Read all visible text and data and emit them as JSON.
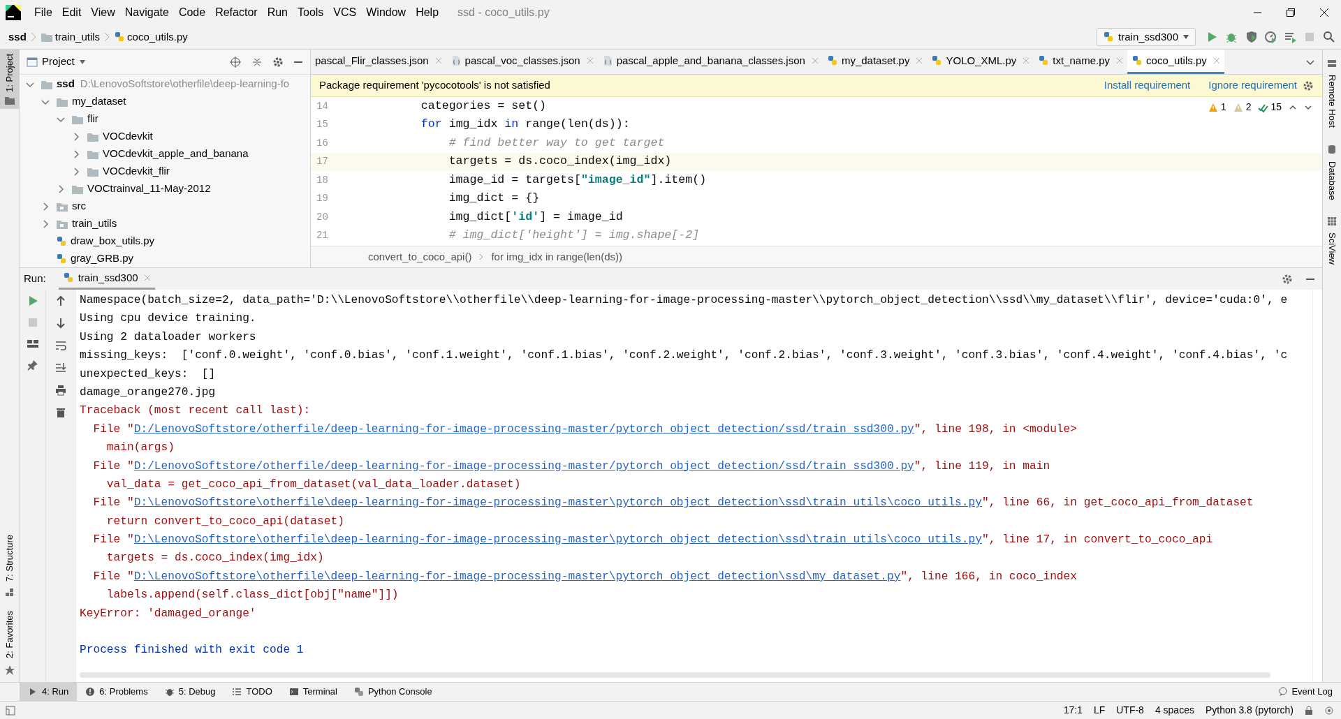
{
  "menu": [
    "File",
    "Edit",
    "View",
    "Navigate",
    "Code",
    "Refactor",
    "Run",
    "Tools",
    "VCS",
    "Window",
    "Help"
  ],
  "window": {
    "title": "ssd - coco_utils.py"
  },
  "nav": {
    "breadcrumbs": [
      {
        "label": "ssd",
        "kind": "project"
      },
      {
        "label": "train_utils",
        "kind": "folder"
      },
      {
        "label": "coco_utils.py",
        "kind": "python_file"
      }
    ],
    "run_config": "train_ssd300"
  },
  "left_strip": [
    "1: Project",
    "7: Structure",
    "2: Favorites"
  ],
  "right_strip": [
    "Remote Host",
    "Database",
    "SciView"
  ],
  "project": {
    "title": "Project",
    "tree": [
      {
        "label": "ssd",
        "path": "D:\\LenovoSoftstore\\otherfile\\deep-learning-fo",
        "kind": "folder",
        "expanded": true,
        "children": [
          {
            "label": "my_dataset",
            "kind": "folder",
            "expanded": true,
            "children": [
              {
                "label": "flir",
                "kind": "folder",
                "expanded": true,
                "children": [
                  {
                    "label": "VOCdevkit",
                    "kind": "folder",
                    "expanded": false
                  },
                  {
                    "label": "VOCdevkit_apple_and_banana",
                    "kind": "folder",
                    "expanded": false
                  },
                  {
                    "label": "VOCdevkit_flir",
                    "kind": "folder",
                    "expanded": false
                  }
                ]
              },
              {
                "label": "VOCtrainval_11-May-2012",
                "kind": "folder",
                "expanded": false
              }
            ]
          },
          {
            "label": "src",
            "kind": "package",
            "expanded": false
          },
          {
            "label": "train_utils",
            "kind": "package",
            "expanded": false
          },
          {
            "label": "draw_box_utils.py",
            "kind": "python_file"
          },
          {
            "label": "gray_GRB.py",
            "kind": "python_file"
          }
        ]
      }
    ]
  },
  "editor_tabs": [
    {
      "label": "pascal_Flir_classes.json",
      "kind": "plain",
      "selected": false
    },
    {
      "label": "pascal_voc_classes.json",
      "kind": "json",
      "selected": false
    },
    {
      "label": "pascal_apple_and_banana_classes.json",
      "kind": "json",
      "selected": false
    },
    {
      "label": "my_dataset.py",
      "kind": "python",
      "selected": false
    },
    {
      "label": "YOLO_XML.py",
      "kind": "python",
      "selected": false
    },
    {
      "label": "txt_name.py",
      "kind": "python",
      "selected": false
    },
    {
      "label": "coco_utils.py",
      "kind": "python",
      "selected": true
    }
  ],
  "banner": {
    "message": "Package requirement 'pycocotools' is not satisfied",
    "actions": [
      "Install requirement",
      "Ignore requirement"
    ]
  },
  "inspections": [
    {
      "kind": "warning",
      "count": "1"
    },
    {
      "kind": "weak_warning",
      "count": "2"
    },
    {
      "kind": "typo",
      "count": "15"
    }
  ],
  "code": [
    {
      "number": "14",
      "current": false,
      "tokens": [
        {
          "kind": "plain",
          "text": "    categories = set()"
        }
      ]
    },
    {
      "number": "15",
      "current": false,
      "tokens": [
        {
          "kind": "keyword",
          "text": "    for"
        },
        {
          "kind": "plain",
          "text": " img_idx "
        },
        {
          "kind": "keyword",
          "text": "in"
        },
        {
          "kind": "plain",
          "text": " range(len(ds)):"
        }
      ]
    },
    {
      "number": "16",
      "current": false,
      "tokens": [
        {
          "kind": "comment",
          "text": "        # find better way to get target"
        }
      ]
    },
    {
      "number": "17",
      "current": true,
      "tokens": [
        {
          "kind": "plain",
          "text": "        targets = ds.coco_index(img_idx)"
        }
      ]
    },
    {
      "number": "18",
      "current": false,
      "tokens": [
        {
          "kind": "plain",
          "text": "        image_id = targets["
        },
        {
          "kind": "string",
          "text": "\"image_id\""
        },
        {
          "kind": "plain",
          "text": "].item()"
        }
      ]
    },
    {
      "number": "19",
      "current": false,
      "tokens": [
        {
          "kind": "plain",
          "text": "        img_dict = {}"
        }
      ]
    },
    {
      "number": "20",
      "current": false,
      "tokens": [
        {
          "kind": "plain",
          "text": "        img_dict["
        },
        {
          "kind": "string",
          "text": "'id'"
        },
        {
          "kind": "plain",
          "text": "] = image_id"
        }
      ]
    },
    {
      "number": "21",
      "current": false,
      "tokens": [
        {
          "kind": "comment",
          "text": "        # img_dict['height'] = img.shape[-2]"
        }
      ]
    }
  ],
  "code_breadcrumbs": [
    "convert_to_coco_api()",
    "for img_idx in range(len(ds))"
  ],
  "run": {
    "label": "Run:",
    "tab": "train_ssd300",
    "console": [
      {
        "kind": "output",
        "parts": [
          {
            "kind": "text",
            "text": "Namespace(batch_size=2, data_path='D:\\\\LenovoSoftstore\\\\otherfile\\\\deep-learning-for-image-processing-master\\\\pytorch_object_detection\\\\ssd\\\\my_dataset\\\\flir', device='cuda:0', e"
          }
        ]
      },
      {
        "kind": "output",
        "parts": [
          {
            "kind": "text",
            "text": "Using cpu device training."
          }
        ]
      },
      {
        "kind": "output",
        "parts": [
          {
            "kind": "text",
            "text": "Using 2 dataloader workers"
          }
        ]
      },
      {
        "kind": "output",
        "parts": [
          {
            "kind": "text",
            "text": "missing_keys:  ['conf.0.weight', 'conf.0.bias', 'conf.1.weight', 'conf.1.bias', 'conf.2.weight', 'conf.2.bias', 'conf.3.weight', 'conf.3.bias', 'conf.4.weight', 'conf.4.bias', 'c"
          }
        ]
      },
      {
        "kind": "output",
        "parts": [
          {
            "kind": "text",
            "text": "unexpected_keys:  []"
          }
        ]
      },
      {
        "kind": "output",
        "parts": [
          {
            "kind": "text",
            "text": "damage_orange270.jpg"
          }
        ]
      },
      {
        "kind": "error",
        "parts": [
          {
            "kind": "text",
            "text": "Traceback (most recent call last):"
          }
        ]
      },
      {
        "kind": "error",
        "parts": [
          {
            "kind": "text",
            "text": "  File \""
          },
          {
            "kind": "link",
            "text": "D:/LenovoSoftstore/otherfile/deep-learning-for-image-processing-master/pytorch_object_detection/ssd/train_ssd300.py"
          },
          {
            "kind": "text",
            "text": "\", line 198, in <module>"
          }
        ]
      },
      {
        "kind": "error",
        "parts": [
          {
            "kind": "text",
            "text": "    main(args)"
          }
        ]
      },
      {
        "kind": "error",
        "parts": [
          {
            "kind": "text",
            "text": "  File \""
          },
          {
            "kind": "link",
            "text": "D:/LenovoSoftstore/otherfile/deep-learning-for-image-processing-master/pytorch_object_detection/ssd/train_ssd300.py"
          },
          {
            "kind": "text",
            "text": "\", line 119, in main"
          }
        ]
      },
      {
        "kind": "error",
        "parts": [
          {
            "kind": "text",
            "text": "    val_data = get_coco_api_from_dataset(val_data_loader.dataset)"
          }
        ]
      },
      {
        "kind": "error",
        "parts": [
          {
            "kind": "text",
            "text": "  File \""
          },
          {
            "kind": "link",
            "text": "D:\\LenovoSoftstore\\otherfile\\deep-learning-for-image-processing-master\\pytorch_object_detection\\ssd\\train_utils\\coco_utils.py"
          },
          {
            "kind": "text",
            "text": "\", line 66, in get_coco_api_from_dataset"
          }
        ]
      },
      {
        "kind": "error",
        "parts": [
          {
            "kind": "text",
            "text": "    return convert_to_coco_api(dataset)"
          }
        ]
      },
      {
        "kind": "error",
        "parts": [
          {
            "kind": "text",
            "text": "  File \""
          },
          {
            "kind": "link",
            "text": "D:\\LenovoSoftstore\\otherfile\\deep-learning-for-image-processing-master\\pytorch_object_detection\\ssd\\train_utils\\coco_utils.py"
          },
          {
            "kind": "text",
            "text": "\", line 17, in convert_to_coco_api"
          }
        ]
      },
      {
        "kind": "error",
        "parts": [
          {
            "kind": "text",
            "text": "    targets = ds.coco_index(img_idx)"
          }
        ]
      },
      {
        "kind": "error",
        "parts": [
          {
            "kind": "text",
            "text": "  File \""
          },
          {
            "kind": "link",
            "text": "D:\\LenovoSoftstore\\otherfile\\deep-learning-for-image-processing-master\\pytorch_object_detection\\ssd\\my_dataset.py"
          },
          {
            "kind": "text",
            "text": "\", line 166, in coco_index"
          }
        ]
      },
      {
        "kind": "error",
        "parts": [
          {
            "kind": "text",
            "text": "    labels.append(self.class_dict[obj[\"name\"]])"
          }
        ]
      },
      {
        "kind": "error",
        "parts": [
          {
            "kind": "text",
            "text": "KeyError: 'damaged_orange'"
          }
        ]
      },
      {
        "kind": "blank"
      },
      {
        "kind": "system",
        "parts": [
          {
            "kind": "text",
            "text": "Process finished with exit code 1"
          }
        ]
      }
    ]
  },
  "tool_tabs": [
    {
      "label": "4: Run",
      "kind": "run",
      "selected": true
    },
    {
      "label": "6: Problems",
      "kind": "problems",
      "selected": false
    },
    {
      "label": "5: Debug",
      "kind": "debug",
      "selected": false
    },
    {
      "label": "TODO",
      "kind": "todo",
      "selected": false
    },
    {
      "label": "Terminal",
      "kind": "terminal",
      "selected": false
    },
    {
      "label": "Python Console",
      "kind": "python",
      "selected": false
    }
  ],
  "event_log": "Event Log",
  "status_bar": [
    "17:1",
    "LF",
    "UTF-8",
    "4 spaces",
    "Python 3.8 (pytorch)"
  ]
}
